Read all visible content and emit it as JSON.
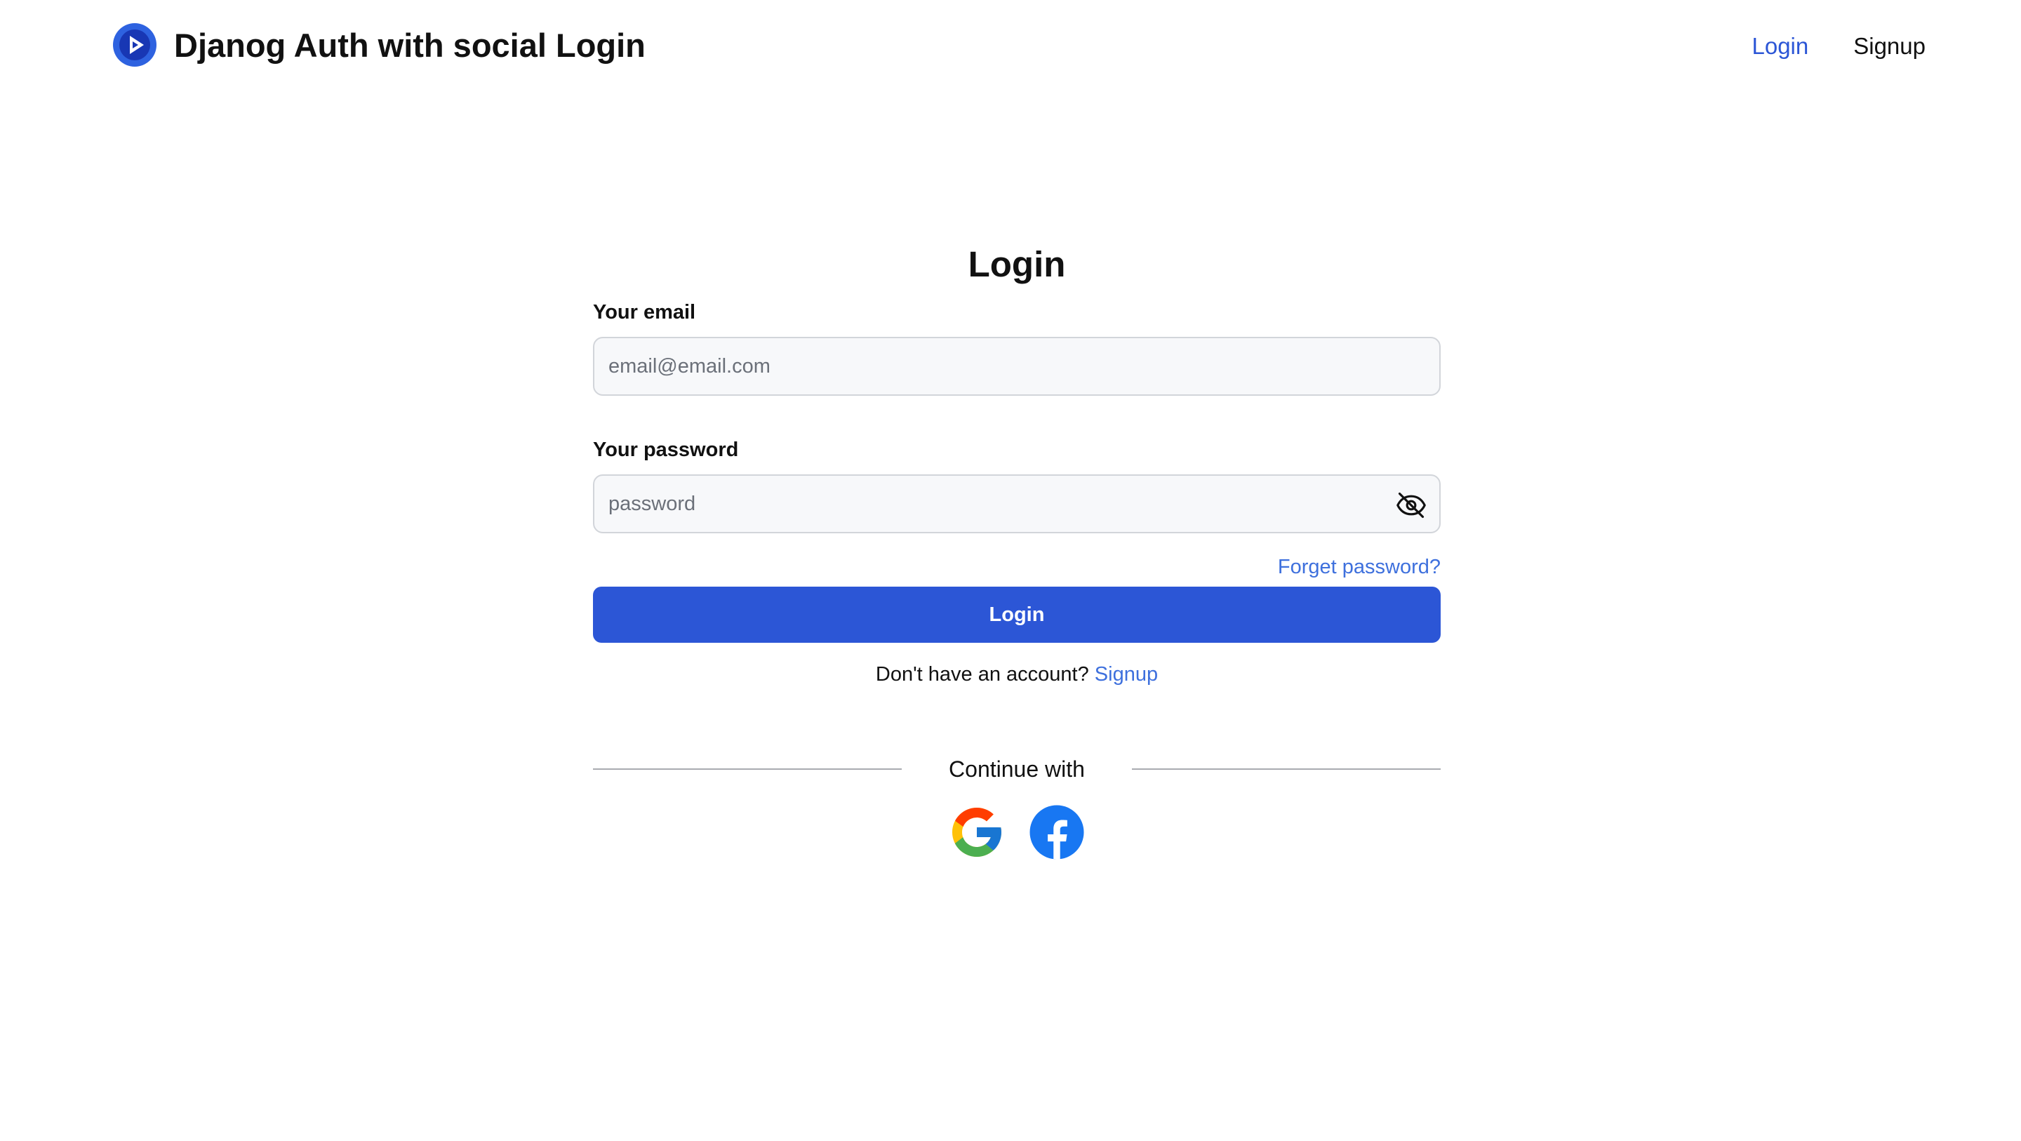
{
  "header": {
    "title": "Djanog Auth with social Login",
    "logo_icon": "play-circle-icon",
    "nav": {
      "login_label": "Login",
      "signup_label": "Signup"
    }
  },
  "form": {
    "title": "Login",
    "email": {
      "label": "Your email",
      "placeholder": "email@email.com",
      "value": ""
    },
    "password": {
      "label": "Your password",
      "placeholder": "password",
      "value": "",
      "toggle_icon": "eye-slash-icon"
    },
    "forgot_label": "Forget password?",
    "submit_label": "Login",
    "signup_prompt": "Don't have an account?",
    "signup_link": "Signup"
  },
  "social": {
    "divider_label": "Continue with",
    "providers": [
      {
        "name": "google",
        "icon": "google-icon"
      },
      {
        "name": "facebook",
        "icon": "facebook-icon"
      }
    ]
  },
  "colors": {
    "primary": "#2c56d6",
    "link": "#3e70dd",
    "input_bg": "#f7f8fa",
    "input_border": "#d2d5da",
    "text": "#111111",
    "facebook": "#1877f2"
  }
}
